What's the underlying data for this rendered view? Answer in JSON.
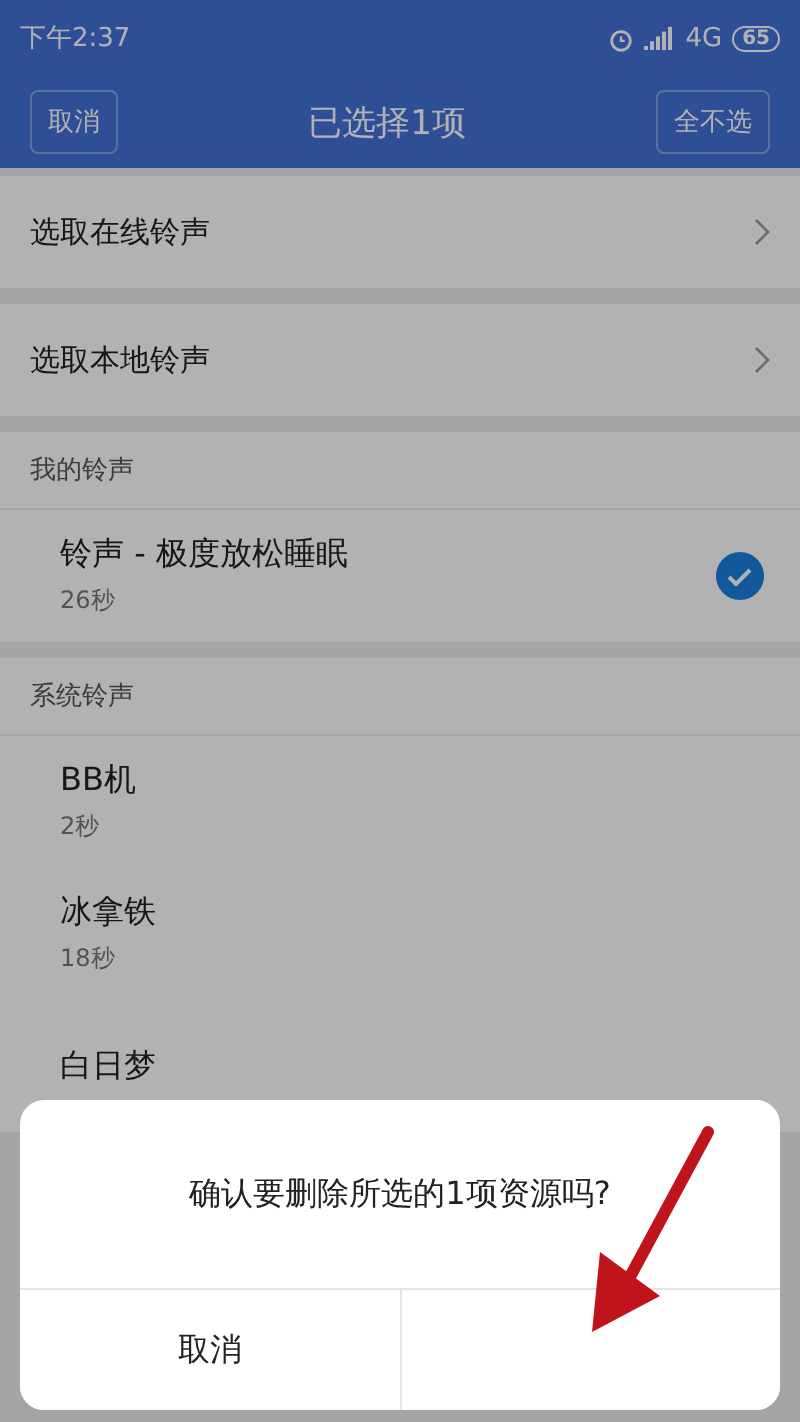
{
  "status_bar": {
    "time": "下午2:37",
    "network": "4G",
    "battery": "65"
  },
  "header": {
    "left_button": "取消",
    "title": "已选择1项",
    "right_button": "全不选"
  },
  "entries": [
    {
      "label": "选取在线铃声"
    },
    {
      "label": "选取本地铃声"
    }
  ],
  "sections": [
    {
      "title": "我的铃声",
      "items": [
        {
          "name": "铃声 - 极度放松睡眠",
          "duration": "26秒",
          "selected": true
        }
      ]
    },
    {
      "title": "系统铃声",
      "items": [
        {
          "name": "BB机",
          "duration": "2秒",
          "selected": false
        },
        {
          "name": "冰拿铁",
          "duration": "18秒",
          "selected": false
        },
        {
          "name": "白日梦",
          "selected": false
        }
      ]
    }
  ],
  "dialog": {
    "message": "确认要删除所选的1项资源吗?",
    "buttons": [
      {
        "label": "取消"
      }
    ]
  }
}
